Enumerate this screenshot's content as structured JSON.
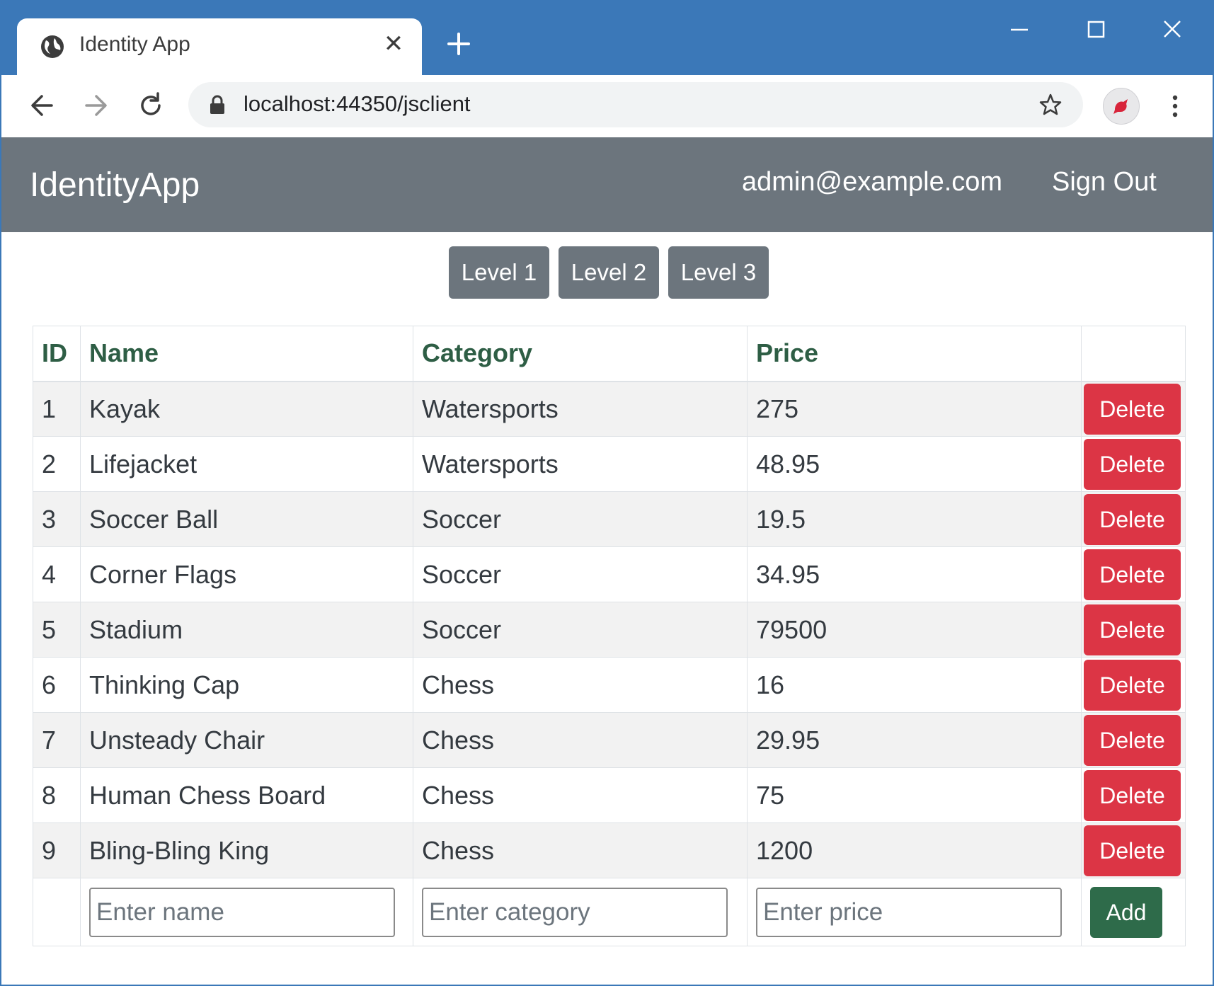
{
  "browser": {
    "tab_title": "Identity App",
    "url": {
      "host": "localhost",
      "port_path": ":44350/jsclient"
    }
  },
  "navbar": {
    "brand": "IdentityApp",
    "user": "admin@example.com",
    "sign_out": "Sign Out"
  },
  "levels": [
    "Level 1",
    "Level 2",
    "Level 3"
  ],
  "table": {
    "headers": {
      "id": "ID",
      "name": "Name",
      "category": "Category",
      "price": "Price"
    },
    "delete_label": "Delete",
    "rows": [
      {
        "id": "1",
        "name": "Kayak",
        "category": "Watersports",
        "price": "275"
      },
      {
        "id": "2",
        "name": "Lifejacket",
        "category": "Watersports",
        "price": "48.95"
      },
      {
        "id": "3",
        "name": "Soccer Ball",
        "category": "Soccer",
        "price": "19.5"
      },
      {
        "id": "4",
        "name": "Corner Flags",
        "category": "Soccer",
        "price": "34.95"
      },
      {
        "id": "5",
        "name": "Stadium",
        "category": "Soccer",
        "price": "79500"
      },
      {
        "id": "6",
        "name": "Thinking Cap",
        "category": "Chess",
        "price": "16"
      },
      {
        "id": "7",
        "name": "Unsteady Chair",
        "category": "Chess",
        "price": "29.95"
      },
      {
        "id": "8",
        "name": "Human Chess Board",
        "category": "Chess",
        "price": "75"
      },
      {
        "id": "9",
        "name": "Bling-Bling King",
        "category": "Chess",
        "price": "1200"
      }
    ],
    "add_form": {
      "name_placeholder": "Enter name",
      "category_placeholder": "Enter category",
      "price_placeholder": "Enter price",
      "add_label": "Add"
    }
  },
  "colors": {
    "titlebar": "#3b78b8",
    "navbar": "#6c757d",
    "delete": "#dc3545",
    "add": "#2e6b4a",
    "header_text": "#2e5e45"
  },
  "icons": {
    "tab_favicon": "globe-icon",
    "tab_close": "close-icon",
    "new_tab": "plus-icon",
    "back": "arrow-left-icon",
    "forward": "arrow-right-icon",
    "reload": "reload-icon",
    "lock": "lock-icon",
    "bookmark": "star-icon",
    "profile": "avatar-bird-icon",
    "menu": "kebab-menu-icon"
  }
}
